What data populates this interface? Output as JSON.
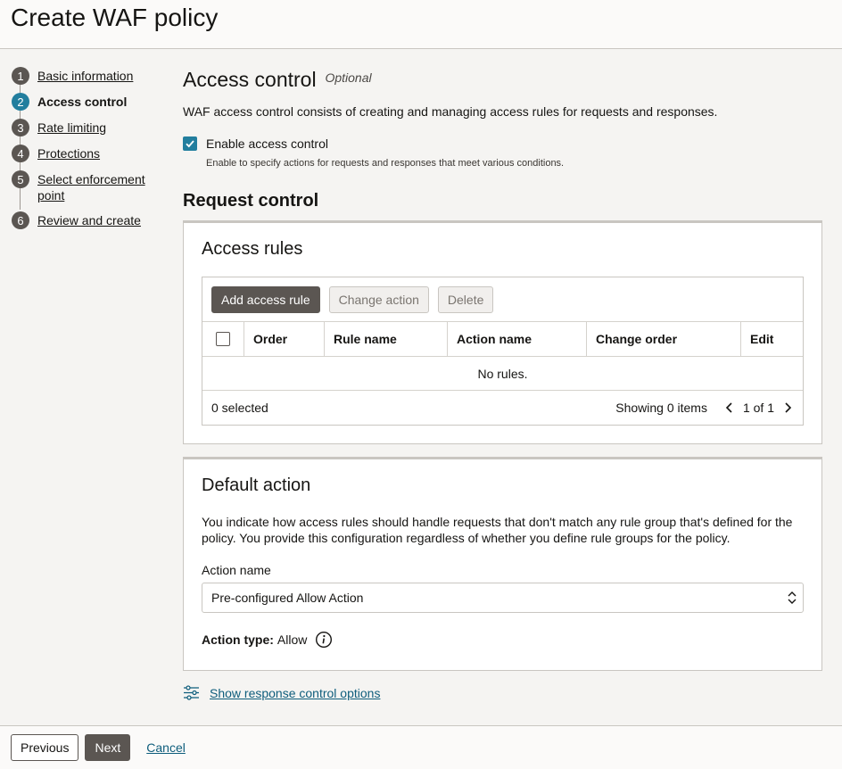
{
  "page": {
    "title": "Create WAF policy"
  },
  "steps": [
    {
      "num": "1",
      "label": "Basic information"
    },
    {
      "num": "2",
      "label": "Access control"
    },
    {
      "num": "3",
      "label": "Rate limiting"
    },
    {
      "num": "4",
      "label": "Protections"
    },
    {
      "num": "5",
      "label": "Select enforcement point"
    },
    {
      "num": "6",
      "label": "Review and create"
    }
  ],
  "access": {
    "title": "Access control",
    "optional": "Optional",
    "description": "WAF access control consists of creating and managing access rules for requests and responses.",
    "enable_label": "Enable access control",
    "enable_checked": true,
    "enable_hint": "Enable to specify actions for requests and responses that meet various conditions."
  },
  "request_control": {
    "title": "Request control",
    "rules_panel": {
      "title": "Access rules",
      "buttons": {
        "add": "Add access rule",
        "change": "Change action",
        "delete": "Delete"
      },
      "columns": [
        "Order",
        "Rule name",
        "Action name",
        "Change order",
        "Edit"
      ],
      "empty_text": "No rules.",
      "selected": "0 selected",
      "showing": "Showing 0 items",
      "pagination": "1 of 1"
    },
    "default_panel": {
      "title": "Default action",
      "description": "You indicate how access rules should handle requests that don't match any rule group that's defined for the policy. You provide this configuration regardless of whether you define rule groups for the policy.",
      "action_name_label": "Action name",
      "action_name_value": "Pre-configured Allow Action",
      "action_type_label": "Action type:",
      "action_type_value": "Allow"
    }
  },
  "response_link": "Show response control options",
  "footer": {
    "previous": "Previous",
    "next": "Next",
    "cancel": "Cancel"
  },
  "colors": {
    "accent": "#227e9e",
    "primary_button": "#5b5652",
    "link": "#0e5d7c"
  }
}
